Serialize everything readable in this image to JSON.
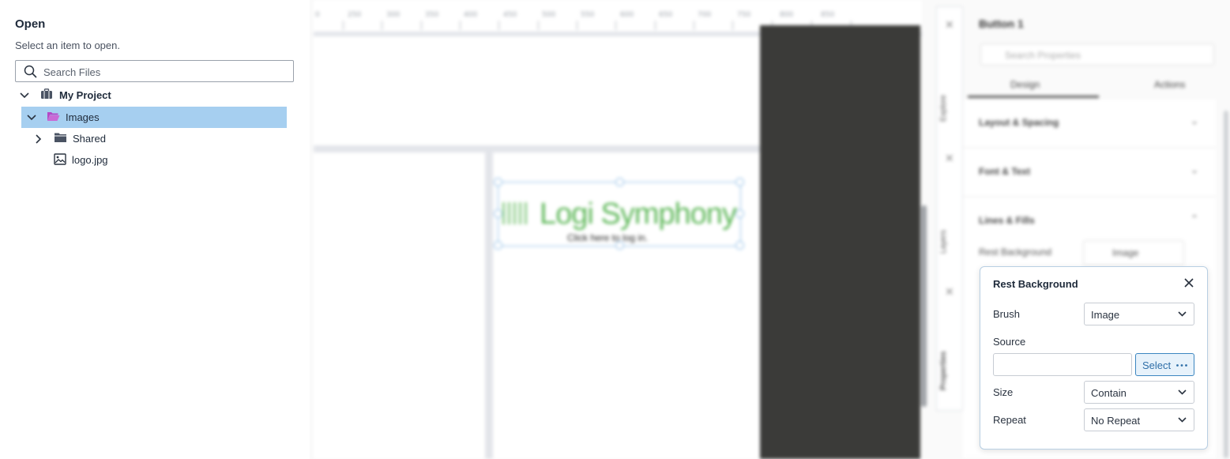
{
  "open_panel": {
    "title": "Open",
    "subtitle": "Select an item to open.",
    "search_placeholder": "Search Files",
    "tree": [
      {
        "label": "My Project",
        "icon": "briefcase-icon",
        "expanded": true
      },
      {
        "label": "Images",
        "icon": "folder-open-icon",
        "expanded": true,
        "selected": true
      },
      {
        "label": "Shared",
        "icon": "folder-icon",
        "expanded": false
      },
      {
        "label": "logo.jpg",
        "icon": "image-file-icon"
      }
    ]
  },
  "canvas": {
    "ruler_labels": [
      "0",
      "250",
      "300",
      "350",
      "400",
      "450",
      "500",
      "550",
      "600",
      "650",
      "700",
      "750",
      "800",
      "850"
    ],
    "logo_text": "Logi Symphony",
    "logo_subtext": "Click here to log in."
  },
  "side_tabs": [
    "Explore",
    "Layers",
    "Properties"
  ],
  "properties_panel": {
    "title": "Button 1",
    "search_placeholder": "Search Properties",
    "tabs": [
      "Design",
      "Actions"
    ],
    "sections": [
      "Layout & Spacing",
      "Font & Text",
      "Lines & Fills"
    ],
    "rest_background_label": "Rest Background",
    "rest_background_value": "Image"
  },
  "popup": {
    "title": "Rest Background",
    "brush_label": "Brush",
    "brush_value": "Image",
    "source_label": "Source",
    "source_value": "",
    "select_button": "Select",
    "size_label": "Size",
    "size_value": "Contain",
    "repeat_label": "Repeat",
    "repeat_value": "No Repeat"
  },
  "colors": {
    "selection": "#a6cff0",
    "accent": "#3c86c0",
    "folder_open": "#b548c6",
    "logo_green": "#5fb85a",
    "dark_pane": "#3b3b39"
  }
}
